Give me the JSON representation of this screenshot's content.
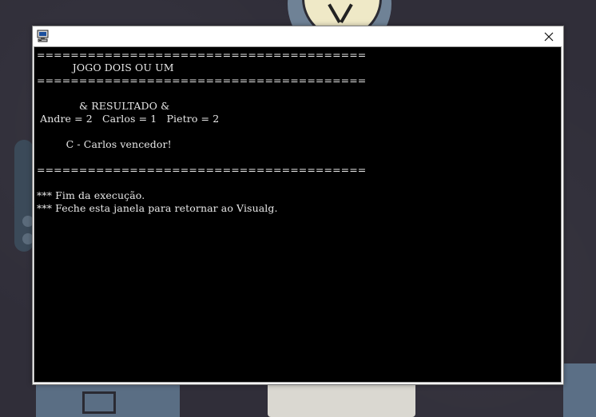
{
  "window": {
    "icon": "console-app-icon",
    "close_icon": "close-icon"
  },
  "console": {
    "lines": [
      "=======================================",
      "           JOGO DOIS OU UM",
      "=======================================",
      "",
      "             & RESULTADO &",
      " Andre = 2   Carlos = 1   Pietro = 2",
      "",
      "         C - Carlos vencedor!",
      "",
      "=======================================",
      "",
      "*** Fim da execução.",
      "*** Feche esta janela para retornar ao Visualg."
    ]
  },
  "colors": {
    "console_background": "#000000",
    "console_text": "#e8e8e8",
    "title_bar": "#ffffff"
  }
}
